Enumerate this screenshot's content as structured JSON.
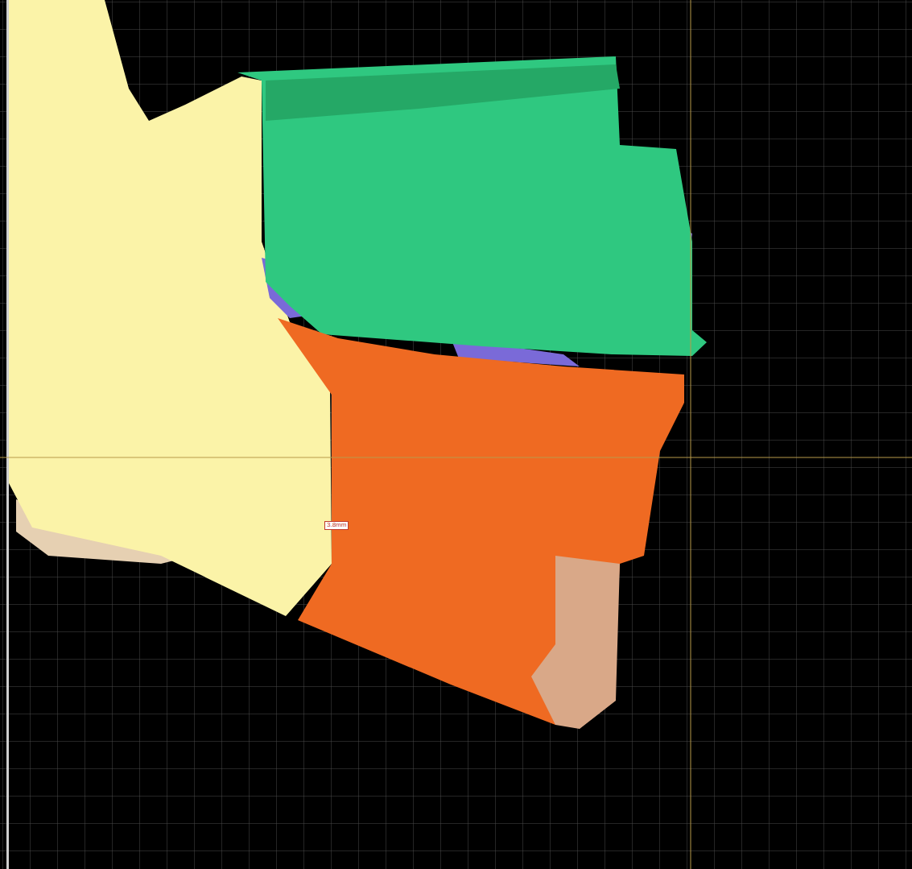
{
  "measurement": {
    "label": "3.8mm"
  }
}
